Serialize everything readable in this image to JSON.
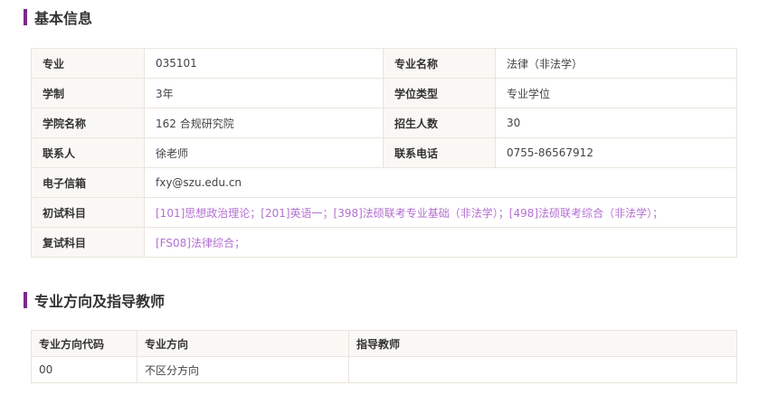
{
  "basic_info": {
    "title": "基本信息",
    "rows": [
      [
        {
          "label": "专业",
          "value": "035101"
        },
        {
          "label": "专业名称",
          "value": "法律（非法学）"
        }
      ],
      [
        {
          "label": "学制",
          "value": "3年"
        },
        {
          "label": "学位类型",
          "value": "专业学位"
        }
      ],
      [
        {
          "label": "学院名称",
          "value": "162 合规研究院"
        },
        {
          "label": "招生人数",
          "value": "30"
        }
      ],
      [
        {
          "label": "联系人",
          "value": "徐老师"
        },
        {
          "label": "联系电话",
          "value": "0755-86567912"
        }
      ]
    ],
    "email": {
      "label": "电子信箱",
      "value": "fxy@szu.edu.cn"
    },
    "initial_exam": {
      "label": "初试科目",
      "value": "[101]思想政治理论；[201]英语一；[398]法硕联考专业基础（非法学）；[498]法硕联考综合（非法学）；"
    },
    "retest": {
      "label": "复试科目",
      "value": "[FS08]法律综合；"
    }
  },
  "directions": {
    "title": "专业方向及指导教师",
    "headers": [
      "专业方向代码",
      "专业方向",
      "指导教师"
    ],
    "rows": [
      [
        "00",
        "不区分方向",
        ""
      ]
    ]
  },
  "colors": {
    "accent": "#7a2c8c",
    "subject_link": "#b46fd2",
    "label_bg": "#faf8f5",
    "border": "#eae5dc"
  }
}
